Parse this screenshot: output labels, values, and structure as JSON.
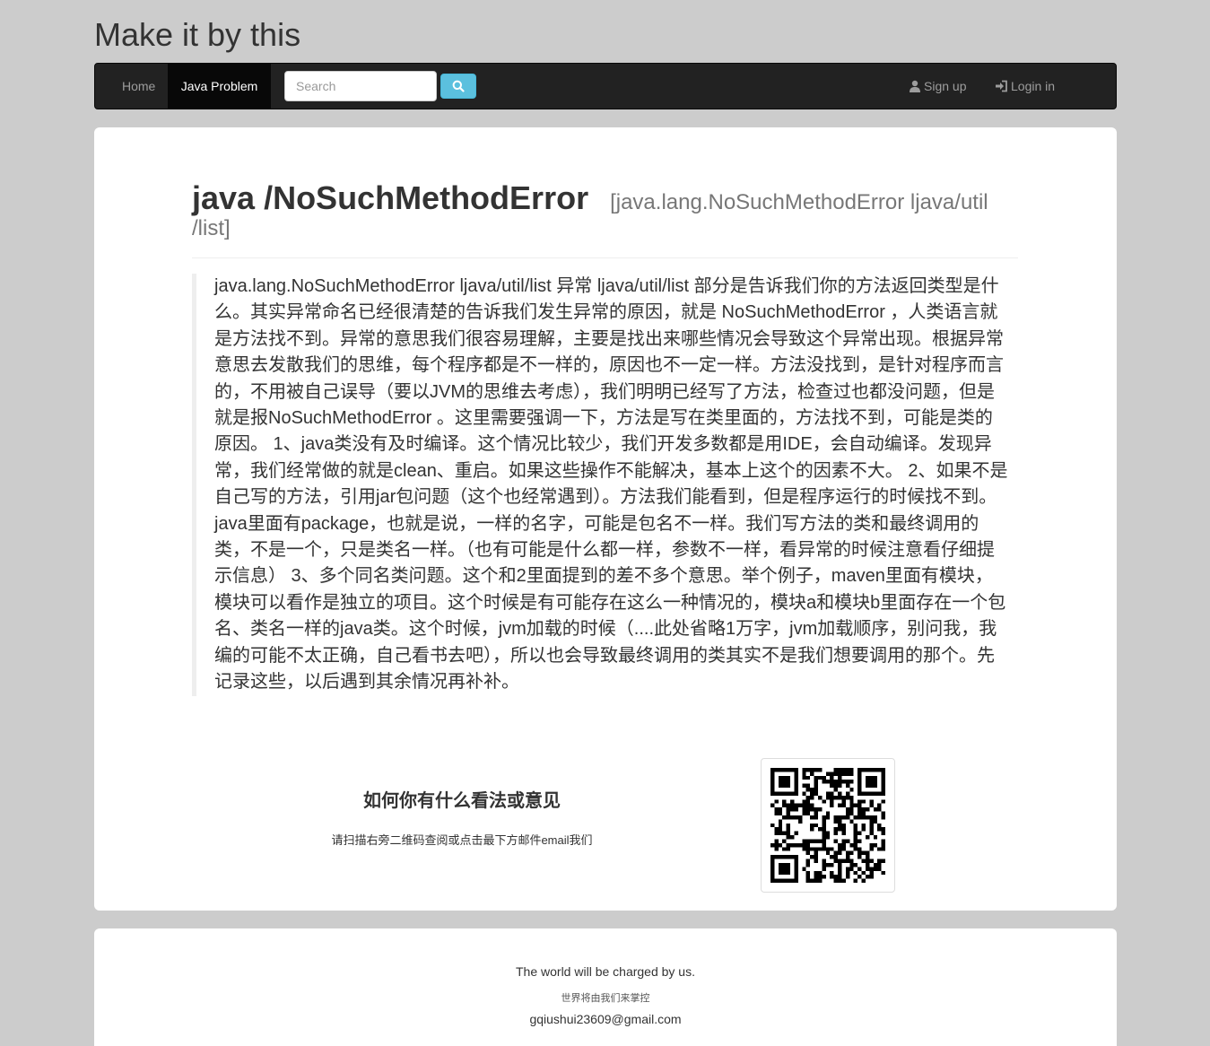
{
  "site": {
    "title": "Make it by this"
  },
  "nav": {
    "home": "Home",
    "java_problem": "Java Problem",
    "search_placeholder": "Search",
    "signup": "Sign up",
    "login": "Login in"
  },
  "article": {
    "title": "java /NoSuchMethodError",
    "subtitle": "[java.lang.NoSuchMethodError ljava/util /list]",
    "body": "java.lang.NoSuchMethodError ljava/util/list 异常 ljava/util/list 部分是告诉我们你的方法返回类型是什么。其实异常命名已经很清楚的告诉我们发生异常的原因，就是 NoSuchMethodError ，人类语言就是方法找不到。异常的意思我们很容易理解，主要是找出来哪些情况会导致这个异常出现。根据异常意思去发散我们的思维，每个程序都是不一样的，原因也不一定一样。方法没找到，是针对程序而言的，不用被自己误导（要以JVM的思维去考虑），我们明明已经写了方法，检查过也都没问题，但是就是报NoSuchMethodError 。这里需要强调一下，方法是写在类里面的，方法找不到，可能是类的原因。 1、java类没有及时编译。这个情况比较少，我们开发多数都是用IDE，会自动编译。发现异常，我们经常做的就是clean、重启。如果这些操作不能解决，基本上这个的因素不大。 2、如果不是自己写的方法，引用jar包问题（这个也经常遇到）。方法我们能看到，但是程序运行的时候找不到。java里面有package，也就是说，一样的名字，可能是包名不一样。我们写方法的类和最终调用的类，不是一个，只是类名一样。（也有可能是什么都一样，参数不一样，看异常的时候注意看仔细提示信息） 3、多个同名类问题。这个和2里面提到的差不多个意思。举个例子，maven里面有模块，模块可以看作是独立的项目。这个时候是有可能存在这么一种情况的，模块a和模块b里面存在一个包名、类名一样的java类。这个时候，jvm加载的时候（....此处省略1万字，jvm加载顺序，别问我，我编的可能不太正确，自己看书去吧），所以也会导致最终调用的类其实不是我们想要调用的那个。先记录这些，以后遇到其余情况再补补。"
  },
  "feedback": {
    "title": "如何你有什么看法或意见",
    "description": "请扫描右旁二维码查阅或点击最下方邮件email我们"
  },
  "footer": {
    "line1": "The world will be charged by us.",
    "line2": "世界将由我们来掌控",
    "email": "gqiushui23609@gmail.com"
  },
  "colors": {
    "navbar": "#222222",
    "search_button": "#5bc0de",
    "background": "#cccccc"
  }
}
